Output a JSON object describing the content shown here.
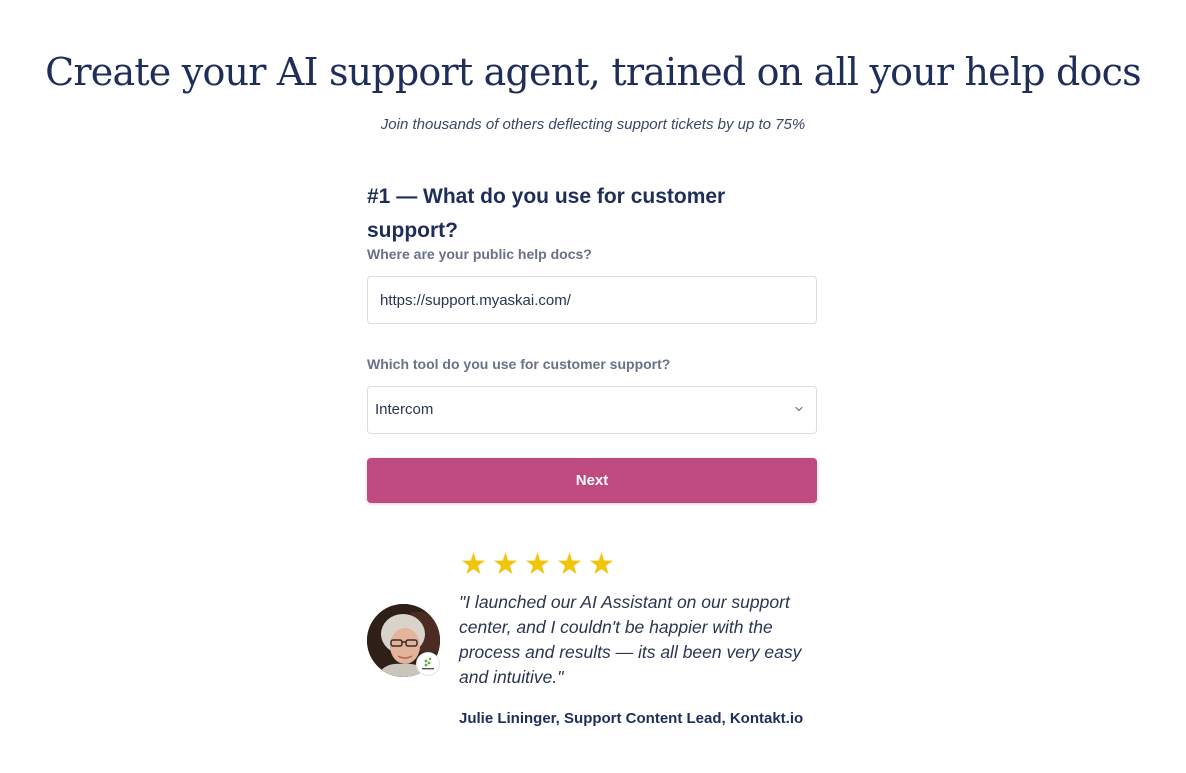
{
  "hero": {
    "title": "Create your AI support agent, trained on all your help docs",
    "subtitle": "Join thousands of others deflecting support tickets by up to 75%"
  },
  "form": {
    "step_heading": "#1 — What do you use for customer support?",
    "help_docs_label": "Where are your public help docs?",
    "help_docs_value": "https://support.myaskai.com/",
    "tool_label": "Which tool do you use for customer support?",
    "tool_value": "Intercom",
    "next_label": "Next"
  },
  "testimonial": {
    "stars": [
      "★",
      "★",
      "★",
      "★",
      "★"
    ],
    "rating": 5,
    "star_color": "#f2c40c",
    "quote": "\"I launched our AI Assistant on our support center, and I couldn't be happier with the process and results — its all been very easy and intuitive.\"",
    "author": "Julie Lininger, Support Content Lead, Kontakt.io",
    "avatar_icon": "person-avatar-icon",
    "badge_icon": "kontakt-logo-icon"
  },
  "colors": {
    "heading": "#1e2d5a",
    "accent": "#bf4a7f"
  }
}
